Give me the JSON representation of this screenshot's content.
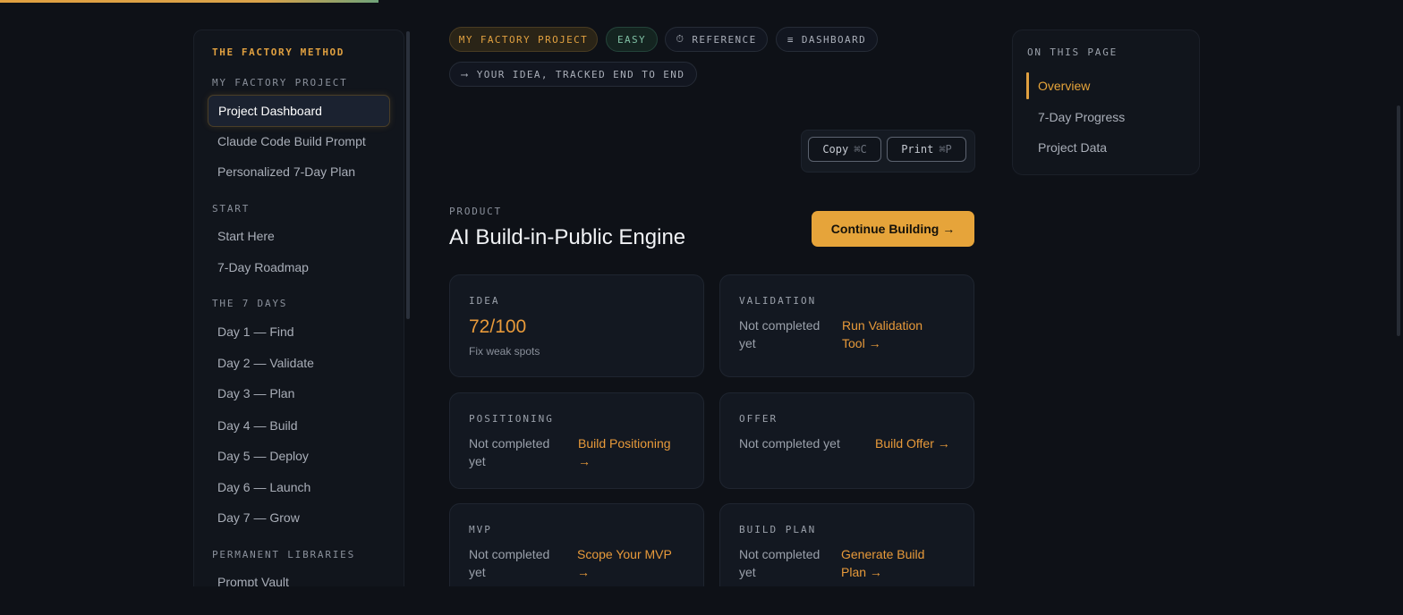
{
  "progress": {
    "percent": 27
  },
  "sidebar": {
    "brand": "THE FACTORY METHOD",
    "sections": [
      {
        "heading": "MY FACTORY PROJECT",
        "items": [
          "Project Dashboard",
          "Claude Code Build Prompt",
          "Personalized 7-Day Plan"
        ]
      },
      {
        "heading": "START",
        "items": [
          "Start Here",
          "7-Day Roadmap"
        ]
      },
      {
        "heading": "THE 7 DAYS",
        "items": [
          "Day 1 — Find",
          "Day 2 — Validate",
          "Day 3 — Plan",
          "Day 4 — Build",
          "Day 5 — Deploy",
          "Day 6 — Launch",
          "Day 7 — Grow"
        ]
      },
      {
        "heading": "PERMANENT LIBRARIES",
        "items": [
          "Prompt Vault"
        ]
      }
    ],
    "active_item": "Project Dashboard"
  },
  "tags": {
    "project": "MY FACTORY PROJECT",
    "difficulty": "EASY",
    "reference": "REFERENCE",
    "dashboard": "DASHBOARD",
    "subtitle": "YOUR IDEA, TRACKED END TO END"
  },
  "icons": {
    "reference": "clock-icon",
    "dashboard": "list-icon",
    "subtitle": "arrow-right-icon"
  },
  "actions": {
    "copy_label": "Copy",
    "copy_shortcut": "⌘C",
    "print_label": "Print",
    "print_shortcut": "⌘P",
    "continue_label": "Continue Building →"
  },
  "product": {
    "label": "PRODUCT",
    "title": "AI Build-in-Public Engine"
  },
  "cards": {
    "idea": {
      "label": "IDEA",
      "score": "72/100",
      "note": "Fix weak spots"
    },
    "validation": {
      "label": "VALIDATION",
      "status_1": "Not completed",
      "status_2": "yet",
      "link_1": "Run Validation",
      "link_2": "Tool →"
    },
    "positioning": {
      "label": "POSITIONING",
      "status_1": "Not completed",
      "status_2": "yet",
      "link_1": "Build Positioning",
      "link_2": "→"
    },
    "offer": {
      "label": "OFFER",
      "status_1": "Not completed yet",
      "link_1": "Build Offer →"
    },
    "mvp": {
      "label": "MVP",
      "status_1": "Not completed",
      "status_2": "yet",
      "link_1": "Scope Your MVP",
      "link_2": "→"
    },
    "build_plan": {
      "label": "BUILD PLAN",
      "status_1": "Not completed",
      "status_2": "yet",
      "link_1": "Generate Build",
      "link_2": "Plan →"
    }
  },
  "toc": {
    "heading": "ON THIS PAGE",
    "items": [
      "Overview",
      "7-Day Progress",
      "Project Data"
    ],
    "active": "Overview"
  },
  "colors": {
    "accent": "#e6a43a",
    "background": "#0e1117",
    "success": "#7fbfa3"
  }
}
